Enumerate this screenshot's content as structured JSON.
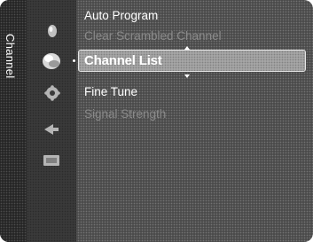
{
  "sidebar": {
    "label": "Channel"
  },
  "icons": [
    "picture-icon",
    "channel-icon",
    "setup-icon",
    "input-icon",
    "support-icon"
  ],
  "menu": {
    "items": [
      {
        "label": "Auto Program",
        "enabled": true
      },
      {
        "label": "Clear Scrambled Channel",
        "enabled": false
      },
      {
        "label": "Channel List",
        "enabled": true,
        "selected": true
      },
      {
        "label": "Fine Tune",
        "enabled": true
      },
      {
        "label": "Signal Strength",
        "enabled": false
      }
    ]
  },
  "colors": {
    "panel": "#4a4a4a",
    "sidebar": "#252525",
    "highlight": "#a6a6a6",
    "enabled_text": "#ffffff",
    "disabled_text": "#8a8a8a"
  }
}
